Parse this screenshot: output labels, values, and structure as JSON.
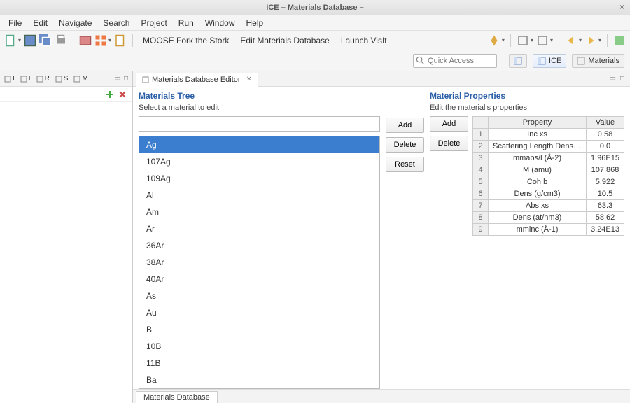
{
  "window": {
    "title": "ICE – Materials Database –"
  },
  "menus": [
    "File",
    "Edit",
    "Navigate",
    "Search",
    "Project",
    "Run",
    "Window",
    "Help"
  ],
  "toolbar_labels": {
    "moose": "MOOSE Fork the Stork",
    "editdb": "Edit Materials Database",
    "visit": "Launch VisIt"
  },
  "quick_access": {
    "placeholder": "Quick Access"
  },
  "perspectives": {
    "ice": "ICE",
    "materials": "Materials"
  },
  "left_tabs": [
    "I",
    "I",
    "R",
    "S",
    "M"
  ],
  "editor_tab": {
    "label": "Materials Database Editor"
  },
  "tree": {
    "title": "Materials Tree",
    "subtitle": "Select a material to edit",
    "items": [
      "Ag",
      "107Ag",
      "109Ag",
      "Al",
      "Am",
      "Ar",
      "36Ar",
      "38Ar",
      "40Ar",
      "As",
      "Au",
      "B",
      "10B",
      "11B",
      "Ba"
    ],
    "selected_index": 0
  },
  "tree_buttons": {
    "add": "Add",
    "delete": "Delete",
    "reset": "Reset"
  },
  "props": {
    "title": "Material Properties",
    "subtitle": "Edit the material's properties",
    "headers": {
      "property": "Property",
      "value": "Value"
    },
    "rows": [
      {
        "n": "1",
        "p": "Inc xs",
        "v": "0.58"
      },
      {
        "n": "2",
        "p": "Scattering Length Densit…",
        "v": "0.0"
      },
      {
        "n": "3",
        "p": "mmabs/l (Å-2)",
        "v": "1.96E15"
      },
      {
        "n": "4",
        "p": "M (amu)",
        "v": "107.868"
      },
      {
        "n": "5",
        "p": "Coh b",
        "v": "5.922"
      },
      {
        "n": "6",
        "p": "Dens (g/cm3)",
        "v": "10.5"
      },
      {
        "n": "7",
        "p": "Abs xs",
        "v": "63.3"
      },
      {
        "n": "8",
        "p": "Dens (at/nm3)",
        "v": "58.62"
      },
      {
        "n": "9",
        "p": "mminc (Å-1)",
        "v": "3.24E13"
      }
    ]
  },
  "prop_buttons": {
    "add": "Add",
    "delete": "Delete"
  },
  "bottom_tab": "Materials Database"
}
